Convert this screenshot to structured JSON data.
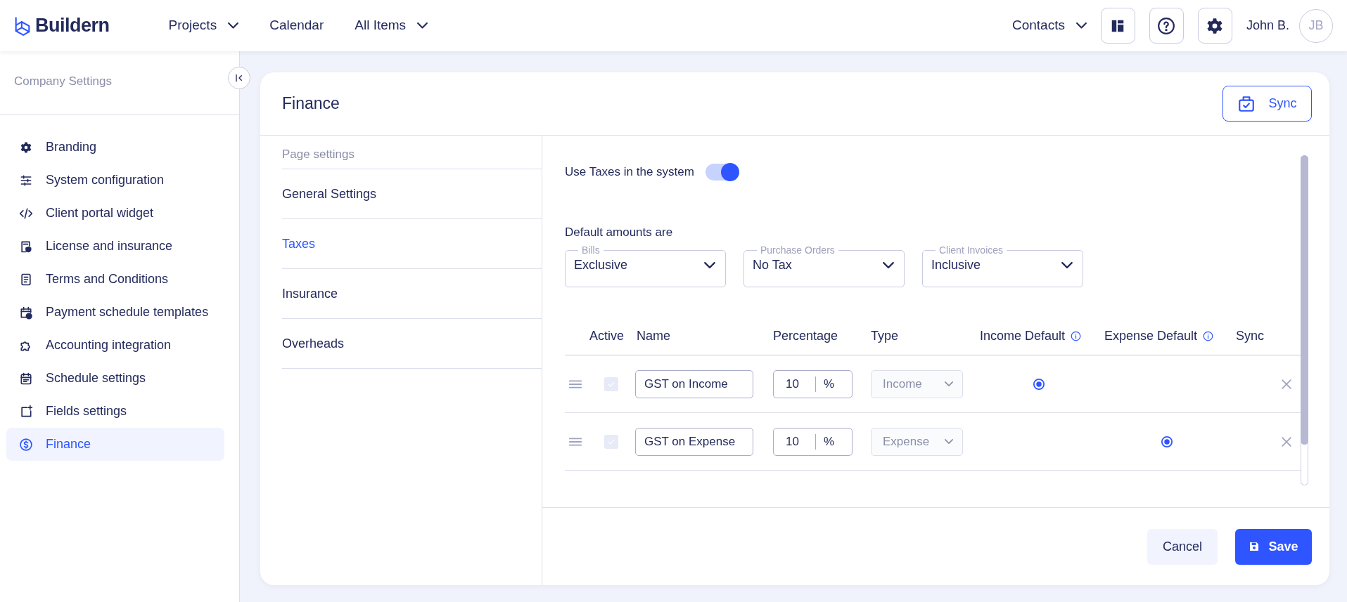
{
  "topbar": {
    "logo": "Buildern",
    "nav": [
      {
        "label": "Projects",
        "dropdown": true
      },
      {
        "label": "Calendar",
        "dropdown": false
      },
      {
        "label": "All Items",
        "dropdown": true
      }
    ],
    "contacts": {
      "label": "Contacts",
      "dropdown": true
    },
    "user_name": "John B.",
    "avatar_initials": "JB"
  },
  "sidebar": {
    "title": "Company Settings",
    "items": [
      {
        "label": "Branding",
        "selected": false
      },
      {
        "label": "System configuration",
        "selected": false
      },
      {
        "label": "Client portal widget",
        "selected": false
      },
      {
        "label": "License and insurance",
        "selected": false
      },
      {
        "label": "Terms and Conditions",
        "selected": false
      },
      {
        "label": "Payment schedule templates",
        "selected": false
      },
      {
        "label": "Accounting integration",
        "selected": false
      },
      {
        "label": "Schedule settings",
        "selected": false
      },
      {
        "label": "Fields settings",
        "selected": false
      },
      {
        "label": "Finance",
        "selected": true
      }
    ]
  },
  "finance": {
    "title": "Finance",
    "sync_button": "Sync",
    "page_settings_title": "Page settings",
    "tabs": [
      {
        "label": "General Settings",
        "selected": false
      },
      {
        "label": "Taxes",
        "selected": true
      },
      {
        "label": "Insurance",
        "selected": false
      },
      {
        "label": "Overheads",
        "selected": false
      }
    ],
    "taxes_toggle": {
      "label": "Use Taxes in the system",
      "on": true
    },
    "defaults_heading": "Default amounts are",
    "selects": [
      {
        "label": "Bills",
        "value": "Exclusive"
      },
      {
        "label": "Purchase Orders",
        "value": "No Tax"
      },
      {
        "label": "Client Invoices",
        "value": "Inclusive"
      }
    ],
    "columns": [
      {
        "label": "Active",
        "info": false
      },
      {
        "label": "Name",
        "info": false
      },
      {
        "label": "Percentage",
        "info": false
      },
      {
        "label": "Type",
        "info": false
      },
      {
        "label": "Income Default",
        "info": true
      },
      {
        "label": "Expense Default",
        "info": true
      },
      {
        "label": "Sync",
        "info": false
      }
    ],
    "rows": [
      {
        "active": true,
        "name": "GST on Income",
        "percentage": "10",
        "unit": "%",
        "type": "Income",
        "income_default": true,
        "expense_default": false
      },
      {
        "active": true,
        "name": "GST on Expense",
        "percentage": "10",
        "unit": "%",
        "type": "Expense",
        "income_default": false,
        "expense_default": true
      }
    ],
    "cancel_button": "Cancel",
    "save_button": "Save"
  }
}
